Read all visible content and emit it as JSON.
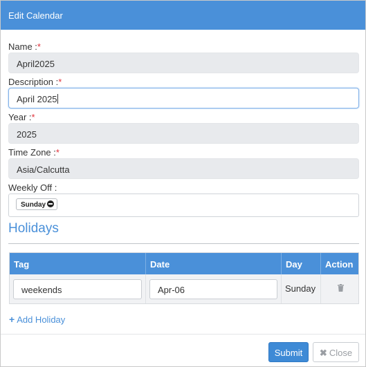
{
  "modal": {
    "title": "Edit Calendar"
  },
  "form": {
    "name": {
      "label": "Name :",
      "required_mark": "*",
      "value": "April2025"
    },
    "description": {
      "label": "Description :",
      "required_mark": "*",
      "value": "April 2025"
    },
    "year": {
      "label": "Year :",
      "required_mark": "*",
      "value": "2025"
    },
    "time_zone": {
      "label": "Time Zone :",
      "required_mark": "*",
      "value": "Asia/Calcutta"
    },
    "weekly_off": {
      "label": "Weekly Off :",
      "chips": [
        "Sunday"
      ]
    }
  },
  "holidays": {
    "title": "Holidays",
    "columns": [
      "Tag",
      "Date",
      "Day",
      "Action"
    ],
    "rows": [
      {
        "tag": "weekends",
        "date": "Apr-06",
        "day": "Sunday",
        "action_icon": "trash-icon"
      }
    ],
    "add_label": "Add Holiday"
  },
  "footer": {
    "submit_label": "Submit",
    "close_label": "Close"
  },
  "colors": {
    "header": "#4a90d9",
    "accent": "#3e8ad6",
    "required": "#e0313a"
  }
}
